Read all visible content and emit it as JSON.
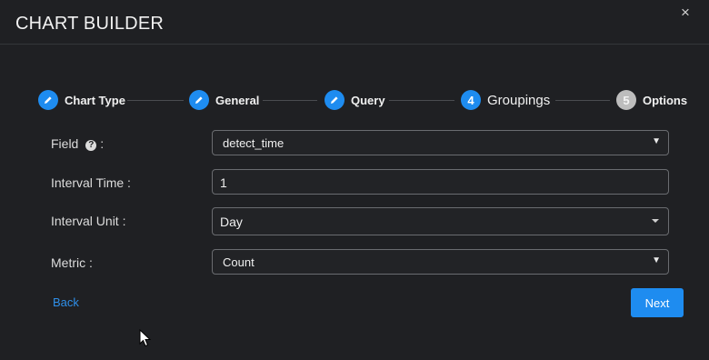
{
  "header": {
    "title": "CHART BUILDER",
    "close_glyph": "×"
  },
  "steps": [
    {
      "label": "Chart Type",
      "state": "done",
      "icon": "pencil-icon"
    },
    {
      "label": "General",
      "state": "done",
      "icon": "pencil-icon"
    },
    {
      "label": "Query",
      "state": "done",
      "icon": "pencil-icon"
    },
    {
      "label": "Groupings",
      "state": "current",
      "number": "4"
    },
    {
      "label": "Options",
      "state": "upcoming",
      "number": "5"
    }
  ],
  "form": {
    "field": {
      "label": "Field",
      "label_suffix": " :",
      "value": "detect_time",
      "help_glyph": "?"
    },
    "interval_time": {
      "label": "Interval Time :",
      "value": "1"
    },
    "interval_unit": {
      "label": "Interval Unit :",
      "value": "Day"
    },
    "metric": {
      "label": "Metric :",
      "value": "Count"
    }
  },
  "footer": {
    "back_label": "Back",
    "next_label": "Next"
  },
  "colors": {
    "accent": "#1e8cf0",
    "background": "#1f2023",
    "link": "#2f8fe8"
  }
}
